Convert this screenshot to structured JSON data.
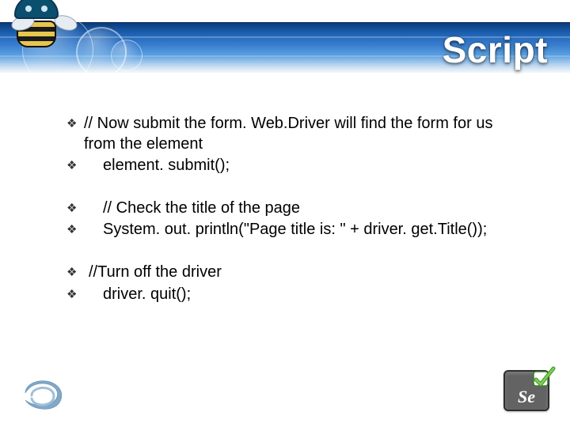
{
  "title": "Script",
  "bullets": [
    {
      "text": " // Now submit the form. Web.Driver will find the form for us from the element",
      "indent": "indent0"
    },
    {
      "text": "element. submit();",
      "indent": "indent1"
    }
  ],
  "bullets2": [
    {
      "text": "// Check the title of the page",
      "indent": "indent1"
    },
    {
      "text": "System. out. println(\"Page title is: \" + driver. get.Title());",
      "indent": "indent1"
    }
  ],
  "bullets3": [
    {
      "text": "//Turn off the driver",
      "indent": "indent-less"
    },
    {
      "text": "driver. quit();",
      "indent": "indent1"
    }
  ],
  "se_label": "Se",
  "icons": {
    "bullet_mark": "❖"
  }
}
